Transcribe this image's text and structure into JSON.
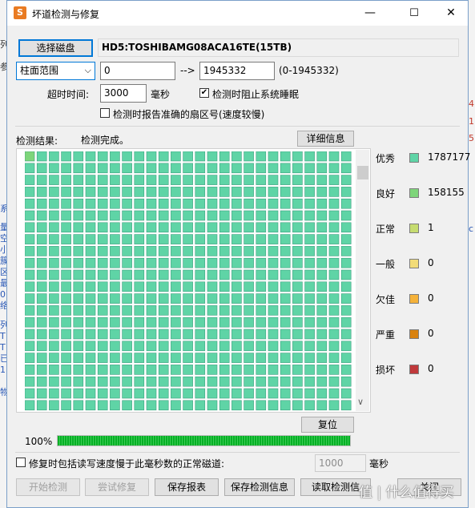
{
  "window": {
    "title": "坏道检测与修复",
    "minimize": "—",
    "maximize": "☐",
    "close": "✕",
    "icon": "app-logo-icon",
    "icon_letter": "S"
  },
  "background_app": {
    "left_glyphs": [
      "列",
      "参",
      "系",
      "量",
      "空",
      "小",
      "簇",
      "区",
      "最",
      "0",
      "络",
      "列",
      "T",
      "T",
      "已",
      "1",
      "物"
    ],
    "right_glyphs": [
      "4",
      "1",
      "5",
      "c"
    ]
  },
  "disk": {
    "select_button": "选择磁盘",
    "name": "HD5:TOSHIBAMG08ACA16TE(15TB)"
  },
  "range": {
    "mode": "柱面范围",
    "start": "0",
    "arrow": "-->",
    "end": "1945332",
    "hint": "(0-1945332)"
  },
  "timeout": {
    "label": "超时时间:",
    "value": "3000",
    "unit": "毫秒"
  },
  "prevent_sleep": {
    "label": "检测时阻止系统睡眠",
    "checked": true
  },
  "report_sector": {
    "label": "检测时报告准确的扇区号(速度较慢)",
    "checked": false
  },
  "results": {
    "label": "检测结果:",
    "status": "检测完成。",
    "detail_button": "详细信息"
  },
  "legend": [
    {
      "name": "优秀",
      "color": "#5fd4a6",
      "count": "1787177"
    },
    {
      "name": "良好",
      "color": "#7ed57a",
      "count": "158155"
    },
    {
      "name": "正常",
      "color": "#c6dc70",
      "count": "1"
    },
    {
      "name": "一般",
      "color": "#f2dc78",
      "count": "0"
    },
    {
      "name": "欠佳",
      "color": "#f5b23a",
      "count": "0"
    },
    {
      "name": "严重",
      "color": "#d9820f",
      "count": "0"
    },
    {
      "name": "损坏",
      "color": "#c0393b",
      "count": "0"
    }
  ],
  "grid_colors": {
    "excellent": "#5fd4a6",
    "good": "#7ed57a",
    "cell_border": "#3aa07e"
  },
  "scroll": {
    "down_arrow": "∨"
  },
  "reset_button": "复位",
  "progress": {
    "label": "100%",
    "value": 1.0
  },
  "repair_option": {
    "label": "修复时包括读写速度慢于此毫秒数的正常磁道:",
    "value": "1000",
    "unit": "毫秒",
    "checked": false
  },
  "actions": {
    "start": "开始检测",
    "try_repair": "尝试修复",
    "save_report": "保存报表",
    "save_info": "保存检测信息",
    "load_info": "读取检测信",
    "close": "关闭"
  },
  "watermark": "值 | 什么值得买"
}
